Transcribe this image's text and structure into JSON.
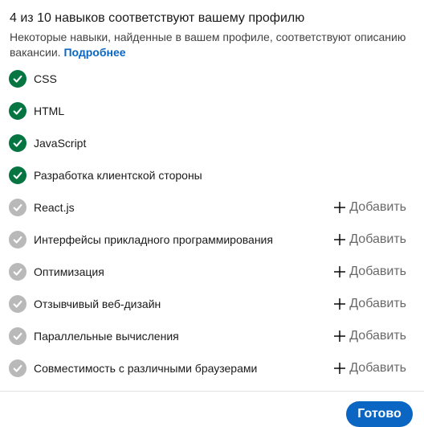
{
  "header": {
    "title": "4 из 10 навыков соответствуют вашему профилю",
    "subtitle": "Некоторые навыки, найденные в вашем профиле, соответствуют описанию вакансии.",
    "more_link": "Подробнее"
  },
  "colors": {
    "matched": "#057642",
    "unmatched": "#b9b9b9",
    "primary": "#0a66c2"
  },
  "skills": [
    {
      "label": "CSS",
      "matched": true
    },
    {
      "label": "HTML",
      "matched": true
    },
    {
      "label": "JavaScript",
      "matched": true
    },
    {
      "label": "Разработка клиентской стороны",
      "matched": true
    },
    {
      "label": "React.js",
      "matched": false
    },
    {
      "label": "Интерфейсы прикладного программирования",
      "matched": false
    },
    {
      "label": "Оптимизация",
      "matched": false
    },
    {
      "label": "Отзывчивый веб-дизайн",
      "matched": false
    },
    {
      "label": "Параллельные вычисления",
      "matched": false
    },
    {
      "label": "Совместимость с различными браузерами",
      "matched": false
    }
  ],
  "add_label": "Добавить",
  "footer": {
    "done_label": "Готово"
  }
}
